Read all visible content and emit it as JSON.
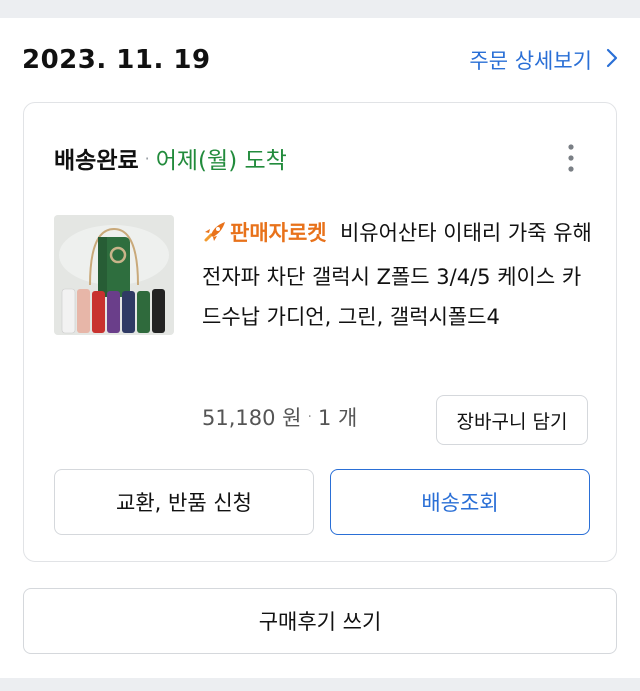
{
  "order": {
    "date": "2023. 11. 19",
    "detail_link": "주문 상세보기"
  },
  "delivery": {
    "status": "배송완료",
    "separator": "·",
    "arrival": "어제(월) 도착"
  },
  "product": {
    "badge": "판매자로켓",
    "title": "비유어산타 이태리 가죽 유해 전자파 차단 갤럭시 Z폴드 3/4/5 케이스 카드수납 가디언, 그린, 갤럭시폴드4",
    "price": "51,180 원",
    "price_separator": "·",
    "quantity": "1 개",
    "cart_button": "장바구니 담기"
  },
  "actions": {
    "exchange": "교환, 반품 신청",
    "track": "배송조회",
    "review": "구매후기 쓰기"
  },
  "colors": {
    "link_blue": "#2a6fd6",
    "arrival_green": "#228b3c",
    "rocket_orange": "#e8721b",
    "background": "#eceef1"
  },
  "icons": {
    "detail_chevron": "chevron-right-icon",
    "more": "more-vertical-icon",
    "rocket": "rocket-icon"
  }
}
